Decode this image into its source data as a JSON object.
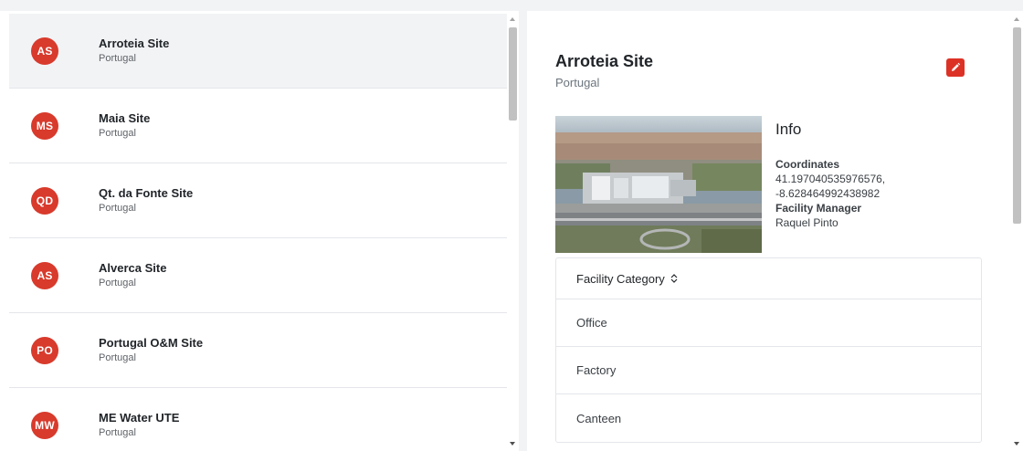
{
  "sites": [
    {
      "initials": "AS",
      "name": "Arroteia Site",
      "country": "Portugal"
    },
    {
      "initials": "MS",
      "name": "Maia Site",
      "country": "Portugal"
    },
    {
      "initials": "QD",
      "name": "Qt. da Fonte Site",
      "country": "Portugal"
    },
    {
      "initials": "AS",
      "name": "Alverca Site",
      "country": "Portugal"
    },
    {
      "initials": "PO",
      "name": "Portugal O&M Site",
      "country": "Portugal"
    },
    {
      "initials": "MW",
      "name": "ME Water UTE",
      "country": "Portugal"
    }
  ],
  "detail": {
    "title": "Arroteia Site",
    "subtitle": "Portugal",
    "info_heading": "Info",
    "coordinates_label": "Coordinates",
    "coordinates_line1": "41.197040535976576,",
    "coordinates_line2": "-8.628464992438982",
    "manager_label": "Facility Manager",
    "manager_value": "Raquel Pinto"
  },
  "table": {
    "header": "Facility Category",
    "rows": [
      "Office",
      "Factory",
      "Canteen"
    ]
  },
  "colors": {
    "accent": "#d83a2c",
    "active_row": "#f2f3f5"
  },
  "icons": {
    "edit": "pencil-icon",
    "sort": "sort-icon"
  }
}
